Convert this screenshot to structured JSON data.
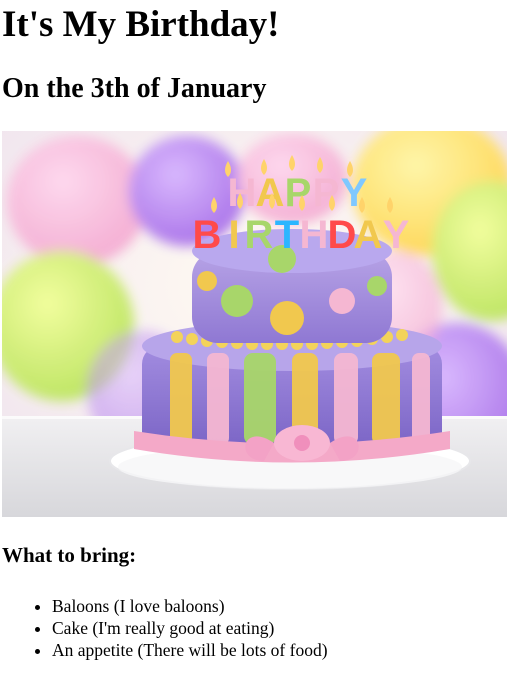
{
  "page": {
    "title": "It's My Birthday!",
    "subtitle": "On the 3th of January",
    "image": {
      "subject": "birthday-cake",
      "colors": {
        "background": "#f6e7f2",
        "cake_top": "#a78ad6",
        "cake_bottom": "#8f7ad0",
        "stripe_yellow": "#f1c84e",
        "stripe_green": "#a8d66a",
        "stripe_pink": "#f5b7d2",
        "ribbon": "#f4a9c8",
        "board": "#ffffff"
      },
      "letters": {
        "line1": "HAPPY",
        "line2": "BIRTHDAY"
      }
    },
    "bring_heading": "What to bring:",
    "bring_items": [
      "Baloons (I love baloons)",
      "Cake (I'm really good at eating)",
      "An appetite (There will be lots of food)"
    ]
  }
}
